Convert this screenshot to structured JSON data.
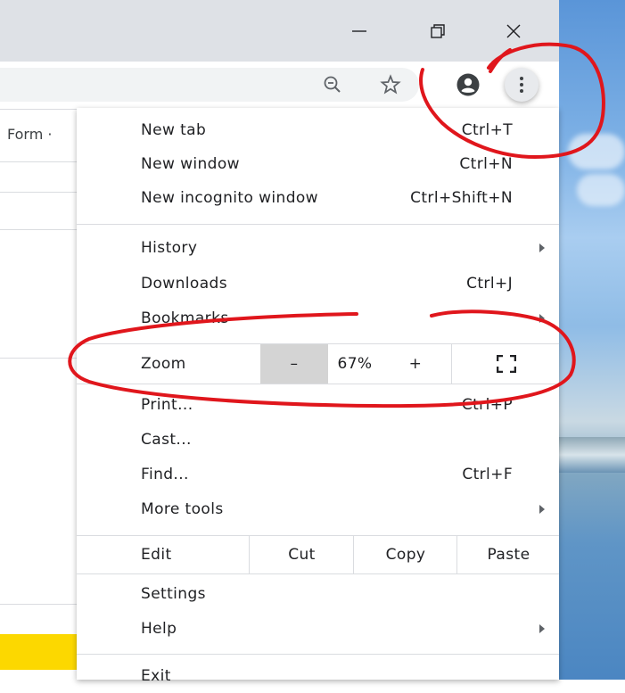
{
  "window_controls": {
    "minimize": "—",
    "restore": "❐",
    "close": "✕"
  },
  "toolbar_icons": [
    "zoom-out-icon",
    "star-icon",
    "profile-icon",
    "more-icon"
  ],
  "page": {
    "partial_text": "Form ·"
  },
  "menu": {
    "group1": [
      {
        "label": "New tab",
        "shortcut": "Ctrl+T"
      },
      {
        "label": "New window",
        "shortcut": "Ctrl+N"
      },
      {
        "label": "New incognito window",
        "shortcut": "Ctrl+Shift+N"
      }
    ],
    "group2": [
      {
        "label": "History",
        "shortcut": ""
      },
      {
        "label": "Downloads",
        "shortcut": "Ctrl+J"
      },
      {
        "label": "Bookmarks",
        "shortcut": ""
      }
    ],
    "zoom": {
      "label": "Zoom",
      "minus": "–",
      "value": "67%",
      "plus": "+"
    },
    "group3": [
      {
        "label": "Print...",
        "shortcut": "Ctrl+P"
      },
      {
        "label": "Cast...",
        "shortcut": ""
      },
      {
        "label": "Find...",
        "shortcut": "Ctrl+F"
      },
      {
        "label": "More tools",
        "shortcut": ""
      }
    ],
    "edit": {
      "label": "Edit",
      "cut": "Cut",
      "copy": "Copy",
      "paste": "Paste"
    },
    "group4": [
      {
        "label": "Settings",
        "shortcut": ""
      },
      {
        "label": "Help",
        "shortcut": ""
      }
    ],
    "exit": {
      "label": "Exit"
    }
  },
  "annotation_color": "#e0161c"
}
